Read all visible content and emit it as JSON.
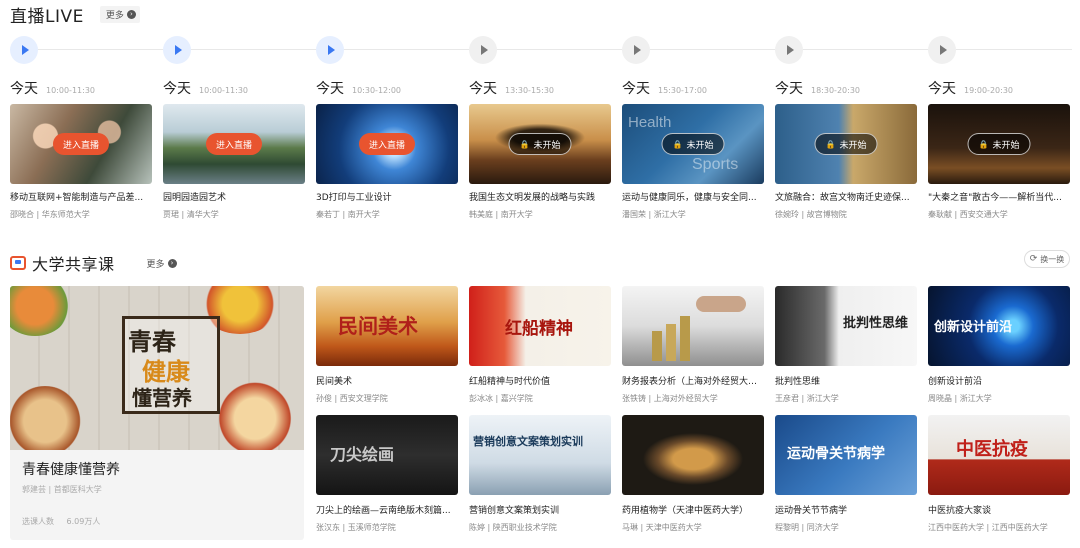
{
  "live": {
    "title": "直播LIVE",
    "more": "更多",
    "items": [
      {
        "day": "今天",
        "time": "10:00-11:30",
        "button": "进入直播",
        "state": "live",
        "name": "移动互联网+智能制造与产品差...",
        "meta": "邵晓合 | 华东师范大学"
      },
      {
        "day": "今天",
        "time": "10:00-11:30",
        "button": "进入直播",
        "state": "live",
        "name": "园明园造园艺术",
        "meta": "贾珺 | 清华大学"
      },
      {
        "day": "今天",
        "time": "10:30-12:00",
        "button": "进入直播",
        "state": "live",
        "name": "3D打印与工业设计",
        "meta": "秦若丁 | 南开大学"
      },
      {
        "day": "今天",
        "time": "13:30-15:30",
        "button": "未开始",
        "state": "soon",
        "name": "我国生态文明发展的战略与实践",
        "meta": "韩美庭 | 南开大学"
      },
      {
        "day": "今天",
        "time": "15:30-17:00",
        "button": "未开始",
        "state": "soon",
        "name": "运动与健康同乐，健康与安全同...",
        "meta": "潘国荣 | 浙江大学"
      },
      {
        "day": "今天",
        "time": "18:30-20:30",
        "button": "未开始",
        "state": "soon",
        "name": "文旅融合：故宫文物南迁史迹保...",
        "meta": "徐婉玲 | 故宫博物院"
      },
      {
        "day": "今天",
        "time": "19:00-20:30",
        "button": "未开始",
        "state": "soon",
        "name": "\"大秦之音\"散古今——解析当代...",
        "meta": "秦耿献 | 西安交通大学"
      }
    ]
  },
  "courses": {
    "title": "大学共享课",
    "more": "更多",
    "shuffle": "换一换",
    "featured": {
      "name": "青春健康懂营养",
      "meta": "郭建芸 | 首都医科大学",
      "stats_label": "选课人数",
      "stats_value": "6.09万人",
      "overlay": [
        "青春",
        "健康",
        "懂营养"
      ]
    },
    "grid": [
      {
        "name": "民间美术",
        "meta": "孙俊 | 西安文理学院",
        "overlay": "民间美术"
      },
      {
        "name": "红船精神与时代价值",
        "meta": "彭冰冰 | 嘉兴学院",
        "overlay": "红船精神"
      },
      {
        "name": "财务报表分析（上海对外经贸大学）",
        "meta": "张铁铸 | 上海对外经贸大学",
        "overlay": ""
      },
      {
        "name": "批判性思维",
        "meta": "王彦君 | 浙江大学",
        "overlay": "批判性思维"
      },
      {
        "name": "创新设计前沿",
        "meta": "周晓晶 | 浙江大学",
        "overlay": "创新设计前沿"
      },
      {
        "name": "刀尖上的绘画—云南绝版木刻篇...",
        "meta": "张汉东 | 玉溪师范学院",
        "overlay": "刀尖绘画"
      },
      {
        "name": "营销创意文案策划实训",
        "meta": "陈婷 | 陕西职业技术学院",
        "overlay": "营销创意文案策划实训"
      },
      {
        "name": "药用植物学（天津中医药大学）",
        "meta": "马琳 | 天津中医药大学",
        "overlay": ""
      },
      {
        "name": "运动骨关节节病学",
        "meta": "程黎明 | 同济大学",
        "overlay": "运动骨关节病学"
      },
      {
        "name": "中医抗疫大家谈",
        "meta": "江西中医药大学 | 江西中医药大学",
        "overlay": "中医抗疫"
      }
    ]
  }
}
